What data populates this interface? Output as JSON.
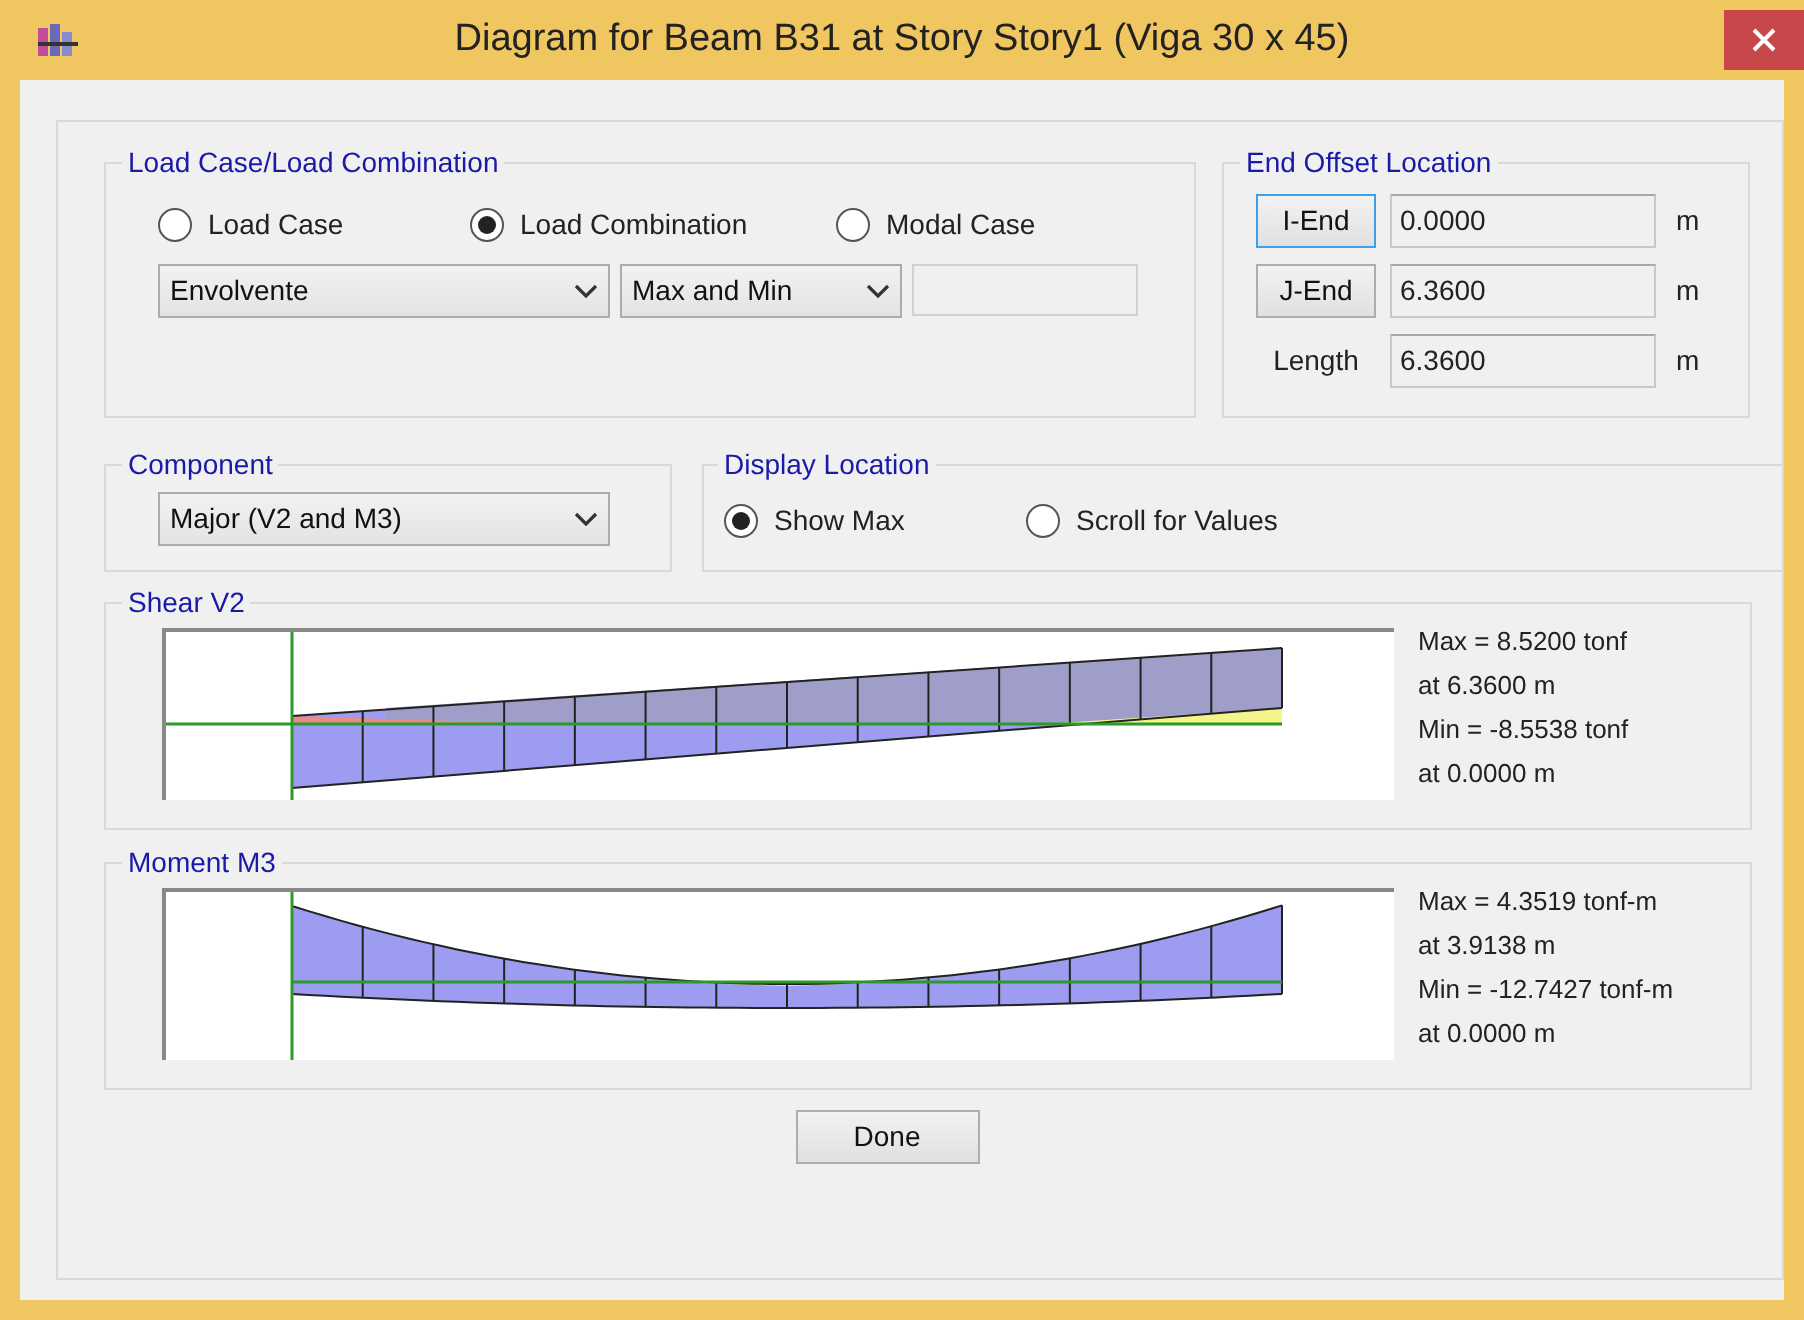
{
  "window": {
    "title": "Diagram for Beam B31 at Story Story1 (Viga 30 x 45)"
  },
  "load_case": {
    "title": "Load Case/Load Combination",
    "options": [
      {
        "label": "Load Case",
        "selected": false
      },
      {
        "label": "Load Combination",
        "selected": true
      },
      {
        "label": "Modal Case",
        "selected": false
      }
    ],
    "combination": "Envolvente",
    "mode": "Max and Min"
  },
  "end_offset": {
    "title": "End Offset Location",
    "rows": [
      {
        "kind": "button",
        "label": "I-End",
        "value": "0.0000",
        "unit": "m",
        "focused": true
      },
      {
        "kind": "button",
        "label": "J-End",
        "value": "6.3600",
        "unit": "m",
        "focused": false
      },
      {
        "kind": "label",
        "label": "Length",
        "value": "6.3600",
        "unit": "m"
      }
    ]
  },
  "component": {
    "title": "Component",
    "value": "Major (V2 and M3)"
  },
  "display_location": {
    "title": "Display Location",
    "options": [
      {
        "label": "Show Max",
        "selected": true
      },
      {
        "label": "Scroll for Values",
        "selected": false
      }
    ]
  },
  "diagrams": [
    {
      "title": "Shear V2",
      "kind": "shear",
      "lines": [
        "Max = 8.5200 tonf",
        "at 6.3600 m",
        "Min = -8.5538 tonf",
        "at 0.0000 m"
      ]
    },
    {
      "title": "Moment M3",
      "kind": "moment",
      "lines": [
        "Max = 4.3519 tonf-m",
        "at 3.9138 m",
        "Min = -12.7427 tonf-m",
        "at 0.0000 m"
      ]
    }
  ],
  "buttons": [
    "Done"
  ]
}
